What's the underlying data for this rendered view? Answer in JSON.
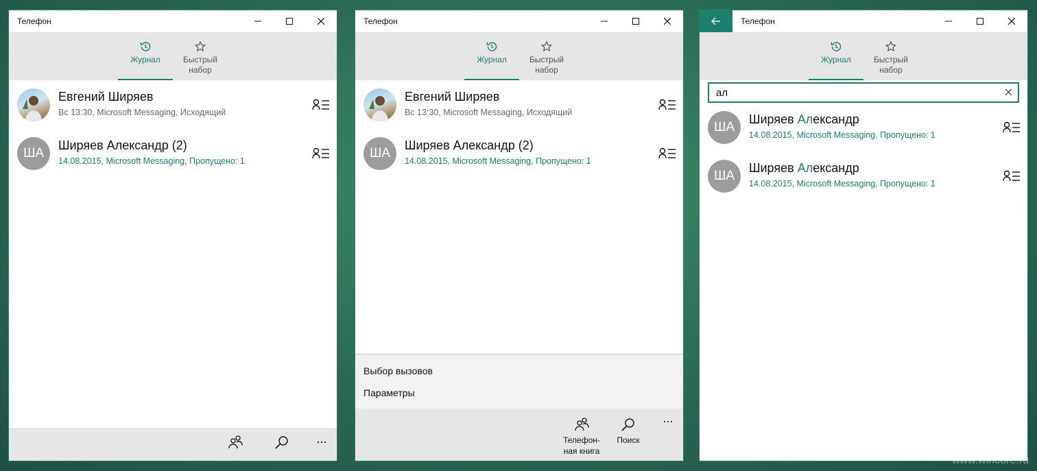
{
  "window_title": "Телефон",
  "tabs": [
    {
      "label": "Журнал",
      "icon": "history-icon",
      "active": true
    },
    {
      "label": "Быстрый набор",
      "label_line1": "Быстрый",
      "label_line2": "набор",
      "icon": "star-icon",
      "active": false
    }
  ],
  "contacts": [
    {
      "name": "Евгений Ширяев",
      "detail": "Вс 13:30, Microsoft Messaging, Исходящий",
      "avatar": "photo"
    },
    {
      "name": "Ширяев Александр (2)",
      "detail": "14.08.2015, Microsoft Messaging, Пропущено: 1",
      "initials": "ША"
    }
  ],
  "flyout": {
    "item1": "Выбор вызовов",
    "item2": "Параметры"
  },
  "appbar": {
    "phonebook_line1": "Телефон-",
    "phonebook_line2": "ная книга",
    "search_label": "Поиск",
    "more": "..."
  },
  "search": {
    "query": "ал",
    "results": [
      {
        "name_highlight": "Ал",
        "name_prefix": "Ширяев ",
        "name_suffix": "ександр",
        "detail": "14.08.2015, Microsoft Messaging, Пропущено: 1",
        "initials": "ША"
      },
      {
        "name_highlight": "Ал",
        "name_prefix": "Ширяев ",
        "name_suffix": "ександр",
        "detail": "14.08.2015, Microsoft Messaging, Пропущено: 1",
        "initials": "ША"
      }
    ]
  },
  "watermark": "www.wincore.ru",
  "colors": {
    "accent": "#1a7f6c",
    "background": "#2c6f58",
    "appbar": "#e6e6e6"
  }
}
